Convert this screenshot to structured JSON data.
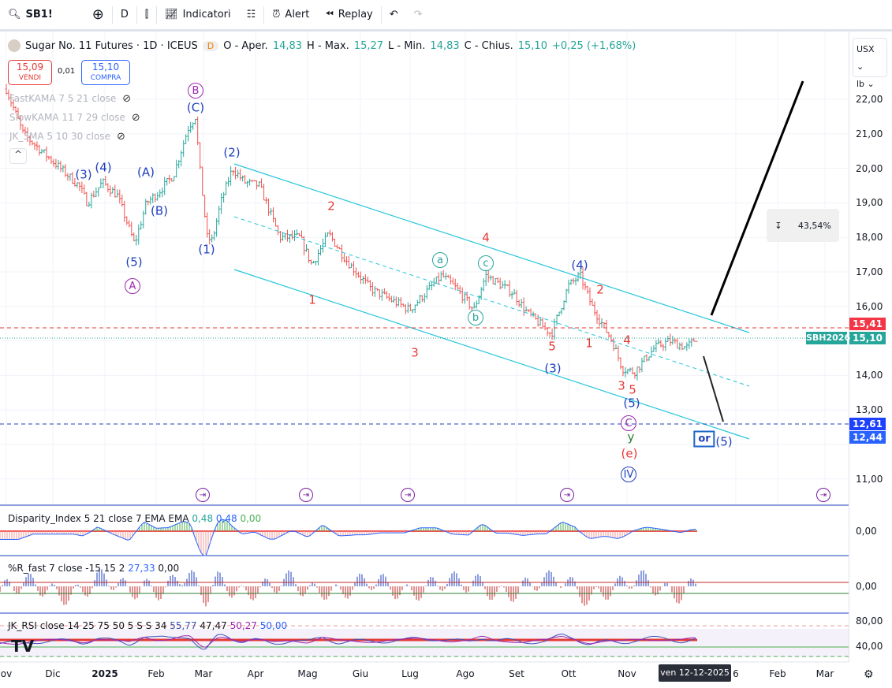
{
  "toolbar": {
    "symbol": "SB1!",
    "interval": "D",
    "indicators": "Indicatori",
    "alert": "Alert",
    "replay": "Replay"
  },
  "legend": {
    "title": "Sugar No. 11 Futures · 1D · ICEUS",
    "badge": "D",
    "o_label": "O - Aper.",
    "o": "14,83",
    "h_label": "H - Max.",
    "h": "15,27",
    "l_label": "L - Min.",
    "l": "14,83",
    "c_label": "C - Chius.",
    "c": "15,10",
    "change": "+0,25 (+1,68%)"
  },
  "trade": {
    "sell_price": "15,09",
    "sell_label": "VENDI",
    "spread": "0,01",
    "buy_price": "15,10",
    "buy_label": "COMPRA"
  },
  "indicators": [
    "FastKAMA 7 5 21 close",
    "SlowKAMA 11 7 29 close",
    "JK_3MA 5 10 30 close"
  ],
  "collapse": "^",
  "units": {
    "currency": "USX",
    "unit": "lb"
  },
  "price_ticks": [
    "22,00",
    "21,00",
    "20,00",
    "19,00",
    "18,00",
    "17,00",
    "16,00",
    "14,00",
    "13,00",
    "11,00"
  ],
  "price_tags": {
    "red": "15,41",
    "last": "15,10",
    "symbol": "SBH2026",
    "blue": "12,61",
    "blue2": "12,44"
  },
  "measure": "43,54%",
  "waves": [
    "B",
    "(C)",
    "(2)",
    "(3)",
    "(4)",
    "(A)",
    "(B)",
    "(5)",
    "A",
    "(1)",
    "2",
    "4",
    "1",
    "3",
    "a",
    "c",
    "b",
    "(4)",
    "2",
    "5",
    "1",
    "4",
    "(3)",
    "3",
    "5",
    "(5)",
    "C",
    "y",
    "(e)",
    "IV",
    "or",
    "(5)"
  ],
  "panes": {
    "disparity": {
      "title": "Disparity_Index 5 21 close 7 EMA EMA",
      "v1": "0,48",
      "v2": "0,48",
      "v3": "0,00",
      "axis": "0,00"
    },
    "wr": {
      "title": "%R_fast 7 close -15 15 2",
      "v1": "27,33",
      "v2": "0,00",
      "axis": "0,00"
    },
    "rsi": {
      "title": "JK_RSI close 14 25 75 50 5 S S 34",
      "v1": "55,77",
      "v2": "47,47",
      "v3": "50,27",
      "v4": "50,00",
      "axis_hi": "80,00",
      "axis_lo": "40,00"
    }
  },
  "time_ticks": [
    "ov",
    "Dic",
    "2025",
    "Feb",
    "Mar",
    "Apr",
    "Mag",
    "Giu",
    "Lug",
    "Ago",
    "Set",
    "Ott",
    "Nov",
    "6",
    "Feb",
    "Mar"
  ],
  "cursor_date": "ven 12-12-2025",
  "chart_data": {
    "type": "ohlc",
    "price_waypoints": [
      [
        0,
        22.3
      ],
      [
        10,
        21.0
      ],
      [
        43,
        19.5
      ],
      [
        48,
        19.0
      ],
      [
        57,
        19.6
      ],
      [
        66,
        19.2
      ],
      [
        76,
        17.8
      ],
      [
        83,
        19.0
      ],
      [
        90,
        19.3
      ],
      [
        99,
        19.8
      ],
      [
        108,
        21.2
      ],
      [
        112,
        21.5
      ],
      [
        115,
        19.8
      ],
      [
        119,
        18.0
      ],
      [
        122,
        17.9
      ],
      [
        127,
        19.0
      ],
      [
        134,
        20.0
      ],
      [
        141,
        19.6
      ],
      [
        150,
        19.5
      ],
      [
        162,
        18.0
      ],
      [
        174,
        18.0
      ],
      [
        181,
        17.2
      ],
      [
        191,
        18.1
      ],
      [
        202,
        17.3
      ],
      [
        216,
        16.5
      ],
      [
        239,
        15.9
      ],
      [
        258,
        16.9
      ],
      [
        267,
        16.5
      ],
      [
        277,
        15.9
      ],
      [
        284,
        16.9
      ],
      [
        300,
        16.4
      ],
      [
        309,
        15.8
      ],
      [
        323,
        15.2
      ],
      [
        333,
        16.6
      ],
      [
        340,
        16.9
      ],
      [
        347,
        16.0
      ],
      [
        359,
        15.0
      ],
      [
        365,
        14.2
      ],
      [
        372,
        14.1
      ],
      [
        384,
        14.8
      ],
      [
        393,
        15.0
      ],
      [
        403,
        14.8
      ],
      [
        409,
        15.1
      ]
    ],
    "ylim": [
      10.5,
      23
    ]
  }
}
